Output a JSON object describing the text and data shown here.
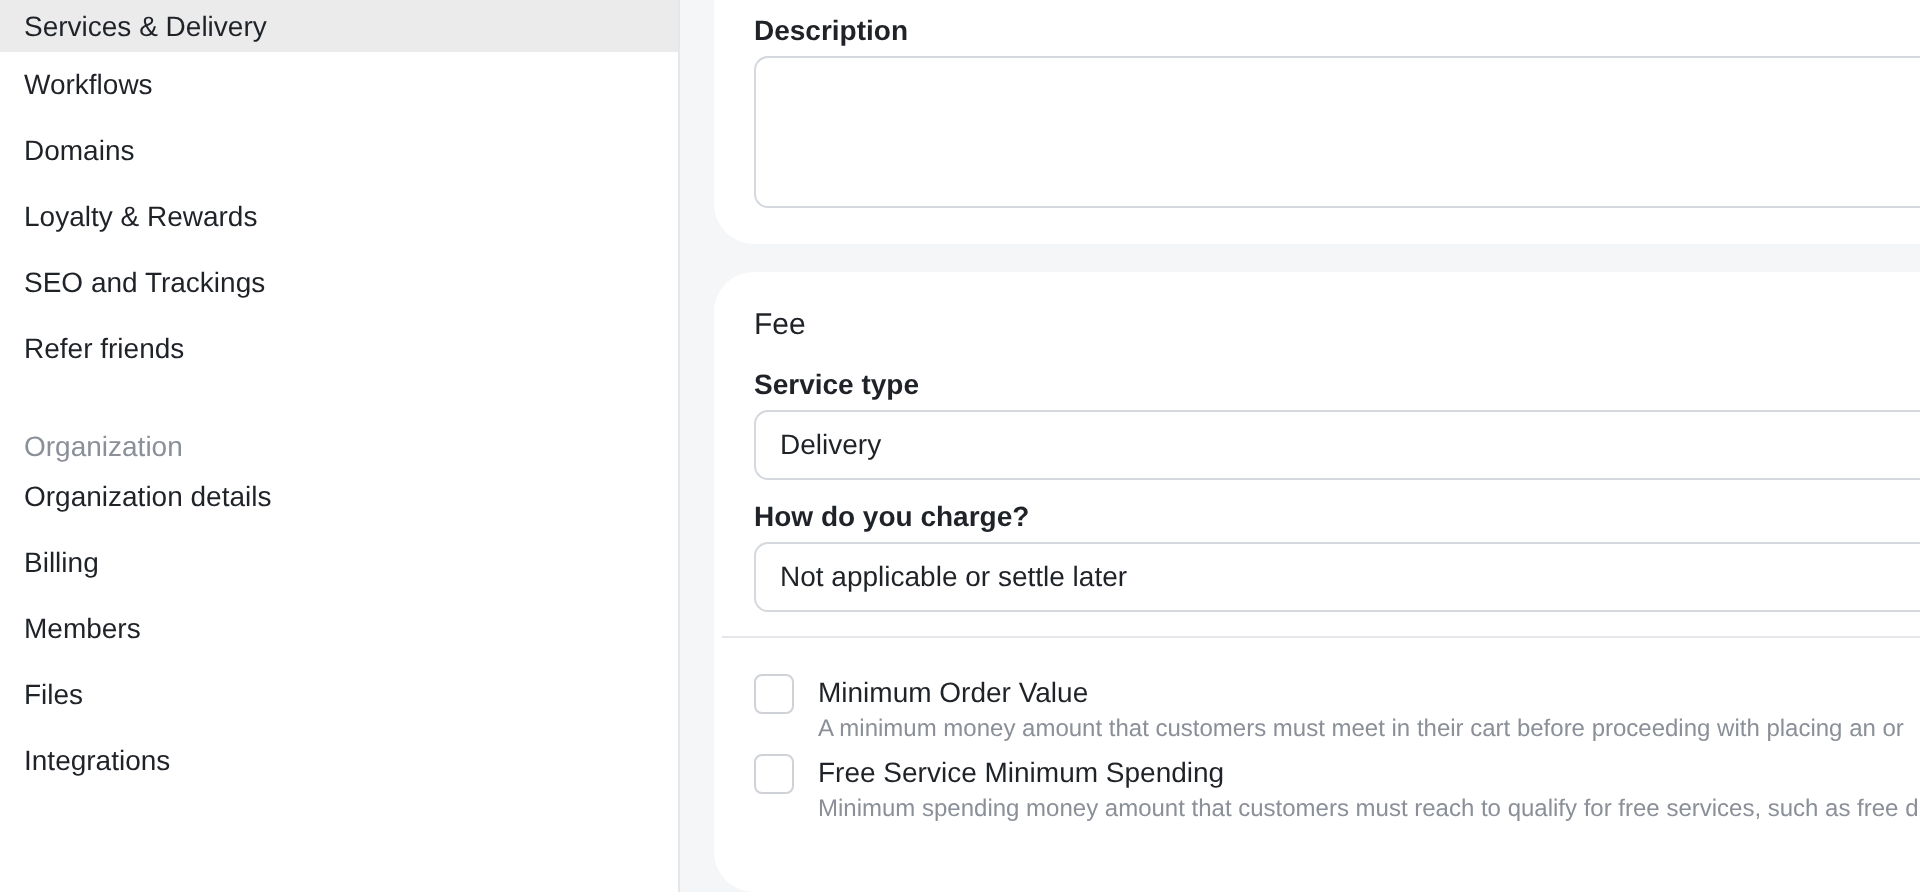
{
  "sidebar": {
    "items": [
      {
        "label": "Services & Delivery",
        "selected": true
      },
      {
        "label": "Workflows",
        "selected": false
      },
      {
        "label": "Domains",
        "selected": false
      },
      {
        "label": "Loyalty & Rewards",
        "selected": false
      },
      {
        "label": "SEO and Trackings",
        "selected": false
      },
      {
        "label": "Refer friends",
        "selected": false
      }
    ],
    "sections": [
      {
        "heading": "Organization",
        "items": [
          {
            "label": "Organization details",
            "selected": false
          },
          {
            "label": "Billing",
            "selected": false
          },
          {
            "label": "Members",
            "selected": false
          },
          {
            "label": "Files",
            "selected": false
          },
          {
            "label": "Integrations",
            "selected": false
          }
        ]
      }
    ]
  },
  "description": {
    "label": "Description"
  },
  "fee": {
    "title": "Fee",
    "fields": [
      {
        "label": "Service type",
        "value": "Delivery"
      },
      {
        "label": "How do you charge?",
        "value": "Not applicable or settle later"
      }
    ],
    "options": [
      {
        "label": "Minimum Order Value",
        "checked": false,
        "hint": "A minimum money amount that customers must meet in their cart before proceeding with placing an or"
      },
      {
        "label": "Free Service Minimum Spending",
        "checked": false,
        "hint": "Minimum spending money amount that customers must reach to qualify for free services, such as free d"
      }
    ]
  }
}
